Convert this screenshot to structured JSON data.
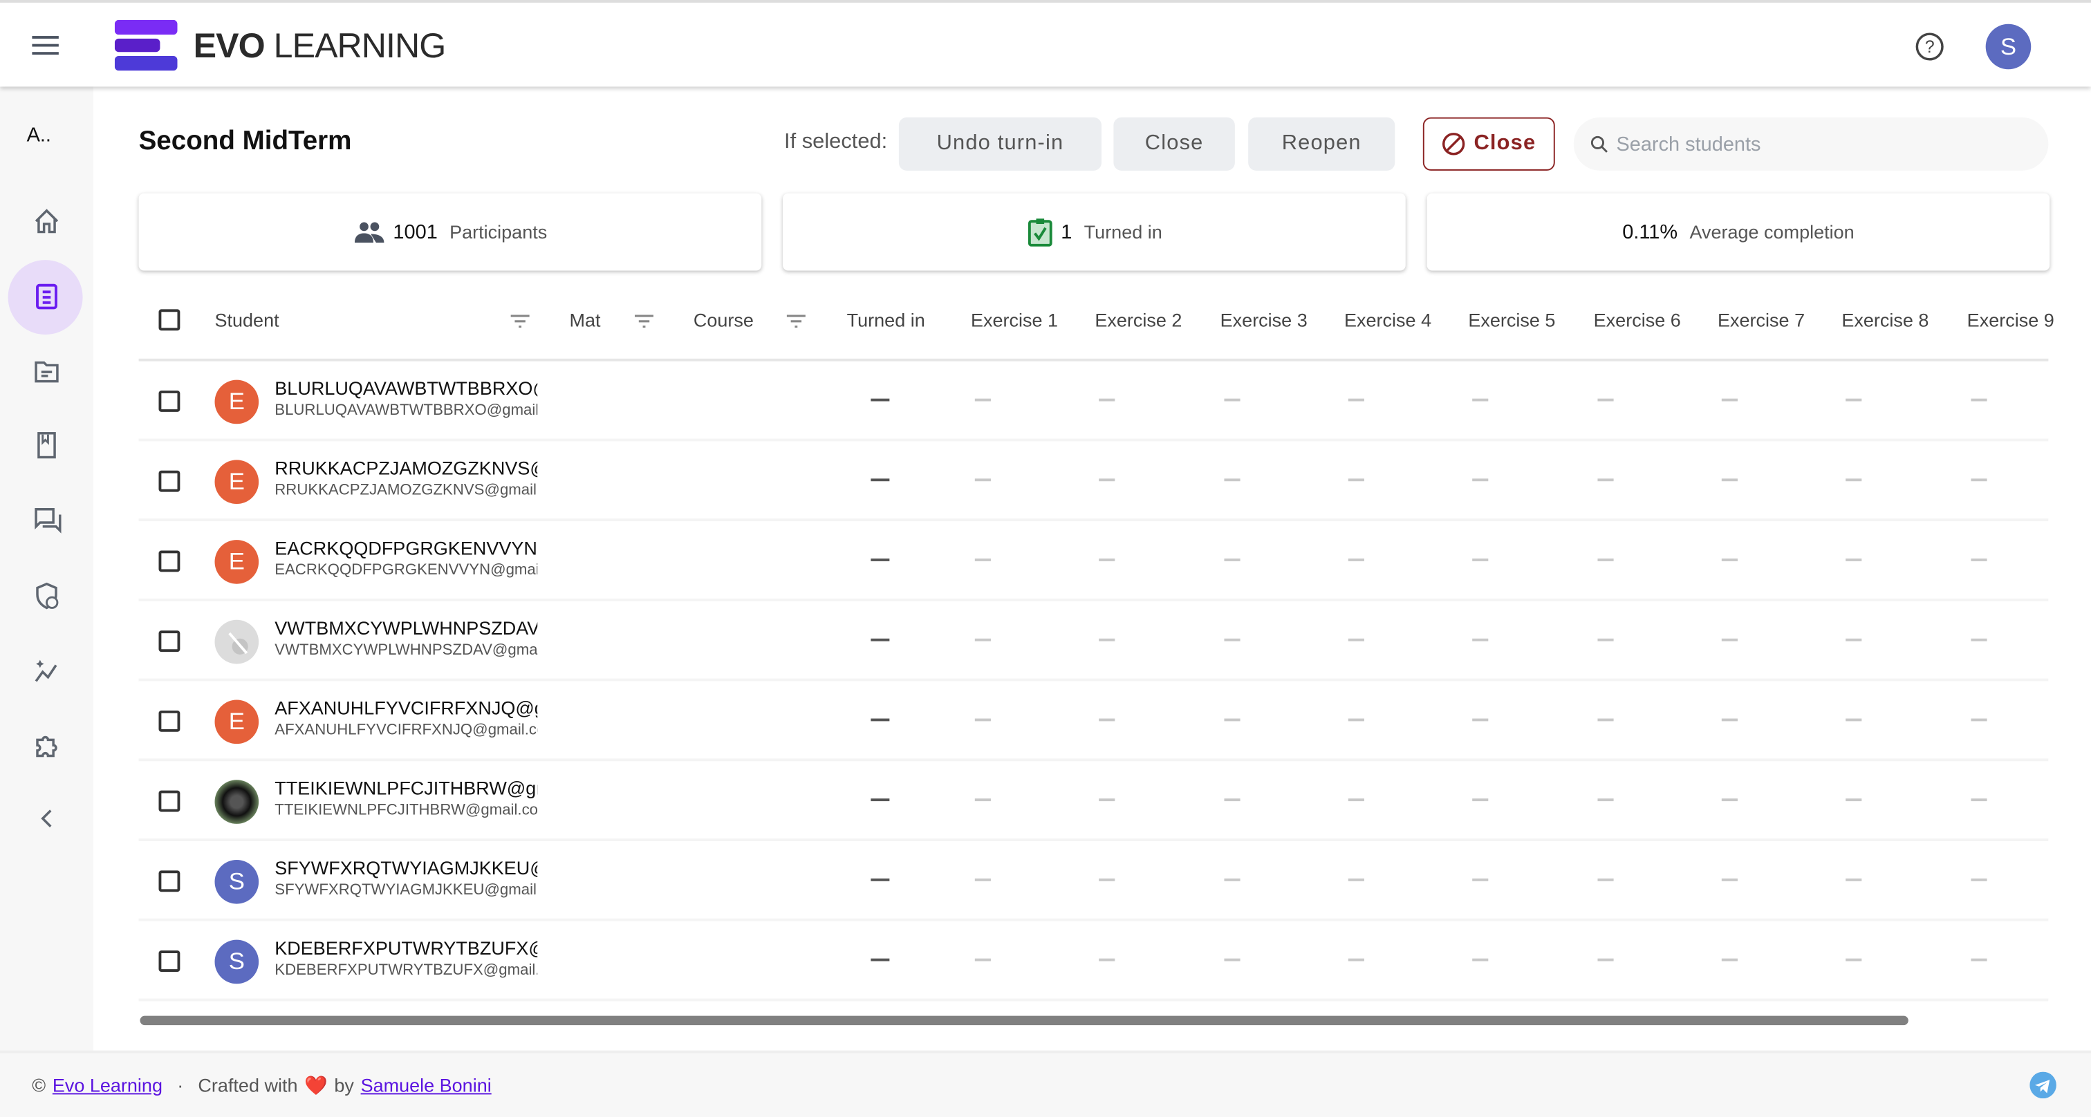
{
  "app": {
    "brand_bold": "EVO",
    "brand_light": "LEARNING",
    "user_initial": "S",
    "accent": "#6a1cf0"
  },
  "sidebar": {
    "course_abbrev": "A..",
    "items": [
      {
        "icon": "home-icon"
      },
      {
        "icon": "assignment-icon",
        "active": true
      },
      {
        "icon": "folder-icon"
      },
      {
        "icon": "book-icon"
      },
      {
        "icon": "forum-icon"
      },
      {
        "icon": "shield-person-icon"
      },
      {
        "icon": "analytics-icon"
      },
      {
        "icon": "extension-icon"
      },
      {
        "icon": "chevron-left-icon"
      }
    ]
  },
  "page": {
    "title": "Second MidTerm"
  },
  "toolbar": {
    "if_selected": "If selected:",
    "undo": "Undo turn-in",
    "close": "Close",
    "reopen": "Reopen",
    "close_assignment": "Close",
    "search_placeholder": "Search students"
  },
  "stats": {
    "participants": {
      "value": "1001",
      "label": "Participants"
    },
    "turned_in": {
      "value": "1",
      "label": "Turned in"
    },
    "avg": {
      "value": "0.11%",
      "label": "Average completion"
    }
  },
  "table": {
    "columns": {
      "student": "Student",
      "mat": "Mat",
      "course": "Course",
      "turned_in": "Turned in",
      "exercises": [
        "Exercise 1",
        "Exercise 2",
        "Exercise 3",
        "Exercise 4",
        "Exercise 5",
        "Exercise 6",
        "Exercise 7",
        "Exercise 8",
        "Exercise 9"
      ]
    },
    "rows": [
      {
        "name": "BLURLUQAVAWBTWTBBRXO@gmail.com",
        "email": "BLURLUQAVAWBTWTBBRXO@gmail.com",
        "avatar": "E",
        "avatar_color": "#e5603a",
        "turned_in": "—"
      },
      {
        "name": "RRUKKACPZJAMOZGZKNVS@gmail.com",
        "email": "RRUKKACPZJAMOZGZKNVS@gmail.com",
        "avatar": "E",
        "avatar_color": "#e5603a",
        "turned_in": "—"
      },
      {
        "name": "EACRKQQDFPGRGKENVVYN@gmail.com",
        "email": "EACRKQQDFPGRGKENVVYN@gmail.com",
        "avatar": "E",
        "avatar_color": "#e5603a",
        "turned_in": "—"
      },
      {
        "name": "VWTBMXCYWPLWHNPSZDAV@gmail.com",
        "email": "VWTBMXCYWPLWHNPSZDAV@gmail.com",
        "avatar": "placeholder",
        "avatar_color": "#dcdcdc",
        "turned_in": "—"
      },
      {
        "name": "AFXANUHLFYVCIFRFXNJQ@gmail.com",
        "email": "AFXANUHLFYVCIFRFXNJQ@gmail.com",
        "avatar": "E",
        "avatar_color": "#e5603a",
        "turned_in": "—"
      },
      {
        "name": "TTEIKIEWNLPFCJITHBRW@gmail.com",
        "email": "TTEIKIEWNLPFCJITHBRW@gmail.com",
        "avatar": "photo",
        "avatar_color": "#2a2a2a",
        "turned_in": "—"
      },
      {
        "name": "SFYWFXRQTWYIAGMJKKEU@gmail.com",
        "email": "SFYWFXRQTWYIAGMJKKEU@gmail.com",
        "avatar": "S",
        "avatar_color": "#5c6bc0",
        "turned_in": "—"
      },
      {
        "name": "KDEBERFXPUTWRYTBZUFX@gmail.com",
        "email": "KDEBERFXPUTWRYTBZUFX@gmail.com",
        "avatar": "S",
        "avatar_color": "#5c6bc0",
        "turned_in": "—"
      }
    ]
  },
  "footer": {
    "copyright": "©",
    "org_link": "Evo Learning",
    "dot": "·",
    "crafted": "Crafted with",
    "heart": "❤️",
    "by": "by",
    "author_link": "Samuele Bonini"
  }
}
